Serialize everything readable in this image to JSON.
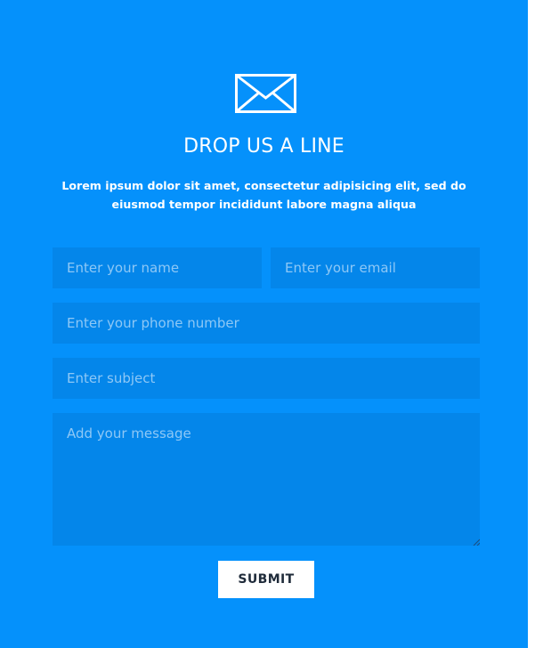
{
  "header": {
    "icon": "envelope-icon",
    "title": "DROP US A LINE",
    "description": "Lorem ipsum dolor sit amet, consectetur adipisicing elit, sed do eiusmod tempor incididunt labore magna aliqua"
  },
  "form": {
    "name_placeholder": "Enter your name",
    "email_placeholder": "Enter your email",
    "phone_placeholder": "Enter your phone number",
    "subject_placeholder": "Enter subject",
    "message_placeholder": "Add your message",
    "submit_label": "SUBMIT"
  },
  "colors": {
    "background": "#0591fb",
    "field_background": "#0486ea",
    "placeholder": "#8ec8f6",
    "button_background": "#ffffff",
    "button_text": "#1f2b3a"
  }
}
